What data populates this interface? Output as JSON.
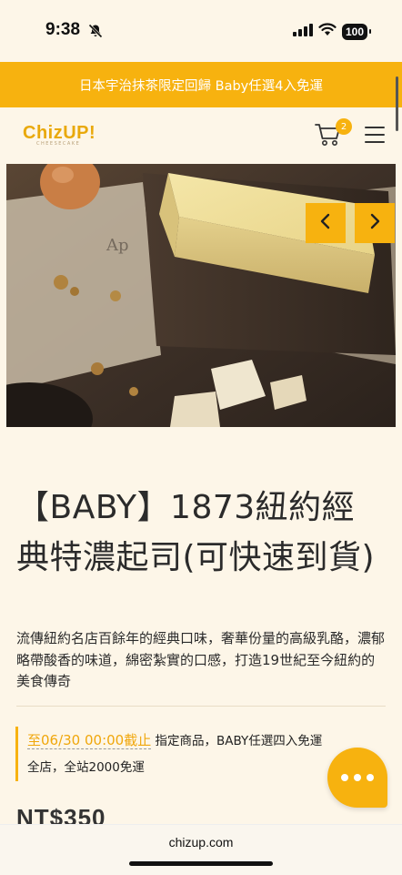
{
  "status_bar": {
    "time": "9:38",
    "battery": "100"
  },
  "announcement": {
    "text": "日本宇治抹茶限定回歸 Baby任選4入免運"
  },
  "header": {
    "logo": "ChizUP!",
    "logo_sub": "CHEESECAKE",
    "cart_count": "2"
  },
  "hero": {
    "prev_icon": "chevron-left-icon",
    "next_icon": "chevron-right-icon"
  },
  "product": {
    "title": "【BABY】1873紐約經典特濃起司(可快速到貨)",
    "description": "流傳紐約名店百餘年的經典口味，奢華份量的高級乳酪，濃郁略帶酸香的味道，綿密紮實的口感，打造19世紀至今紐約的美食傳奇",
    "promo_highlight": "至06/30 00:00截止",
    "promo_rest": " 指定商品，BABY任選四入免運",
    "promo_line2": "全店，全站2000免運",
    "price": "NT$350"
  },
  "browser": {
    "url": "chizup.com"
  },
  "colors": {
    "brand": "#f7b20f",
    "background": "#fdf6e8"
  }
}
